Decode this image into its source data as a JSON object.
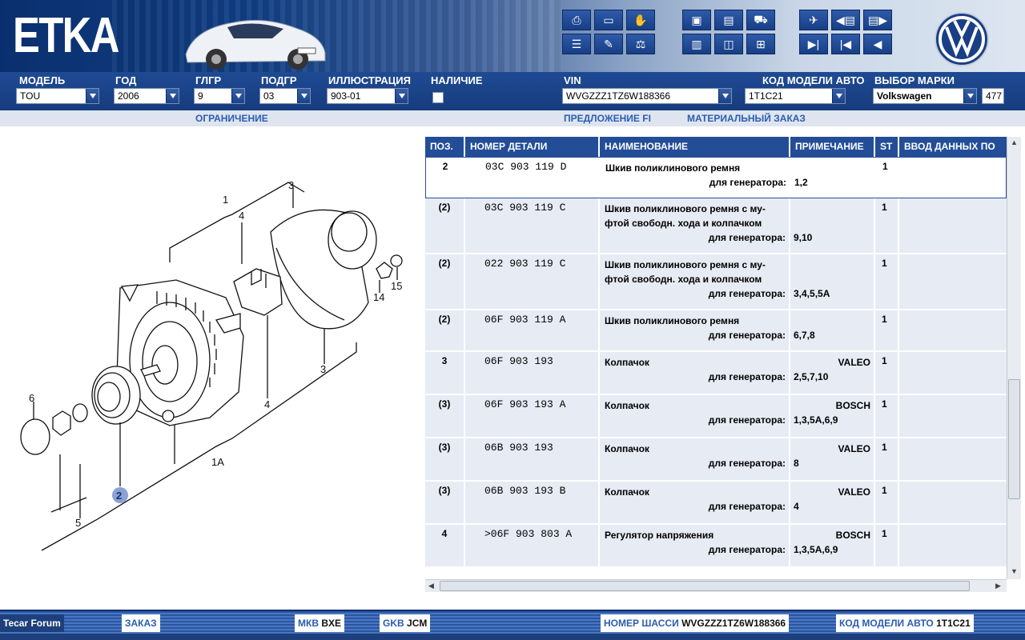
{
  "app": {
    "logo": "ETKA"
  },
  "header": {
    "fields": [
      {
        "id": "model",
        "label": "МОДЕЛЬ",
        "value": "TOU"
      },
      {
        "id": "year",
        "label": "ГОД",
        "value": "2006"
      },
      {
        "id": "main_group",
        "label": "ГЛГР",
        "value": "9"
      },
      {
        "id": "sub_group",
        "label": "ПОДГР",
        "value": "03"
      },
      {
        "id": "illustration",
        "label": "ИЛЛЮСТРАЦИЯ",
        "value": "903-01"
      },
      {
        "id": "availability",
        "label": "НАЛИЧИЕ",
        "value": ""
      },
      {
        "id": "vin",
        "label": "VIN",
        "value": "WVGZZZ1TZ6W188366"
      },
      {
        "id": "model_code",
        "label": "КОД МОДЕЛИ АВТО",
        "value": "1T1C21"
      },
      {
        "id": "brand",
        "label": "ВЫБОР МАРКИ",
        "value": "Volkswagen",
        "extra": "477"
      }
    ],
    "links": {
      "restriction": "ОГРАНИЧЕНИЕ",
      "offer": "ПРЕДЛОЖЕНИЕ FI",
      "material_order": "МАТЕРИАЛЬНЫЙ ЗАКАЗ"
    }
  },
  "diagram": {
    "callouts": [
      "1",
      "3",
      "4",
      "14",
      "15",
      "3",
      "4",
      "6",
      "1A",
      "5"
    ],
    "selected_callout": "2"
  },
  "table": {
    "columns": [
      "ПОЗ.",
      "НОМЕР ДЕТАЛИ",
      "НАИМЕНОВАНИЕ",
      "ПРИМЕЧАНИЕ",
      "ST",
      "ВВОД ДАННЫХ ПО"
    ],
    "gen_label": "для генератора:",
    "rows": [
      {
        "pos": "2",
        "num": "03C 903 119 D",
        "name": [
          "Шкив поликлинового ремня"
        ],
        "brand": "",
        "note": "1,2",
        "st": "1",
        "selected": true
      },
      {
        "pos": "(2)",
        "num": "03C 903 119 C",
        "name": [
          "Шкив поликлинового ремня с му-",
          "фтой свободн. хода и колпачком"
        ],
        "brand": "",
        "note": "9,10",
        "st": "1"
      },
      {
        "pos": "(2)",
        "num": "022 903 119 C",
        "name": [
          "Шкив поликлинового ремня с му-",
          "фтой свободн. хода и колпачком"
        ],
        "brand": "",
        "note": "3,4,5,5A",
        "st": "1"
      },
      {
        "pos": "(2)",
        "num": "06F 903 119 A",
        "name": [
          "Шкив поликлинового ремня"
        ],
        "brand": "",
        "note": "6,7,8",
        "st": "1"
      },
      {
        "pos": "3",
        "num": "06F 903 193",
        "name": [
          "Колпачок"
        ],
        "brand": "VALEO",
        "note": "2,5,7,10",
        "st": "1"
      },
      {
        "pos": "(3)",
        "num": "06F 903 193 A",
        "name": [
          "Колпачок"
        ],
        "brand": "BOSCH",
        "note": "1,3,5A,6,9",
        "st": "1"
      },
      {
        "pos": "(3)",
        "num": "06B 903 193",
        "name": [
          "Колпачок"
        ],
        "brand": "VALEO",
        "note": "8",
        "st": "1"
      },
      {
        "pos": "(3)",
        "num": "06B 903 193 B",
        "name": [
          "Колпачок"
        ],
        "brand": "VALEO",
        "note": "4",
        "st": "1"
      },
      {
        "pos": "4",
        "num": ">06F 903 803 A",
        "name": [
          "Регулятор напряжения"
        ],
        "brand": "BOSCH",
        "note": "1,3,5A,6,9",
        "st": "1"
      }
    ]
  },
  "status": {
    "forum": "Tecar Forum",
    "order": "ЗАКАЗ",
    "mkb_label": "МКВ",
    "mkb_value": "BXE",
    "gkb_label": "GKB",
    "gkb_value": "JCM",
    "chassis_label": "НОМЕР ШАССИ",
    "chassis_value": "WVGZZZ1TZ6W188366",
    "model_label": "КОД МОДЕЛИ АВТО",
    "model_value": "1T1C21"
  },
  "colors": {
    "header_blue": "#163c7e",
    "table_header": "#234e97",
    "row_bg": "#e6ebf4",
    "link": "#2a5db3"
  },
  "toolbar_icons": [
    "printer-icon",
    "book-icon",
    "handshake-icon",
    "list-icon",
    "pencil-icon",
    "scale-icon",
    "elsa-icon",
    "depot-icon",
    "cart-icon",
    "tools-icon",
    "car-icon",
    "basket-icon",
    "pin-icon",
    "prev-page-icon",
    "next-page-icon",
    "last-icon",
    "first-icon",
    "back-icon"
  ]
}
